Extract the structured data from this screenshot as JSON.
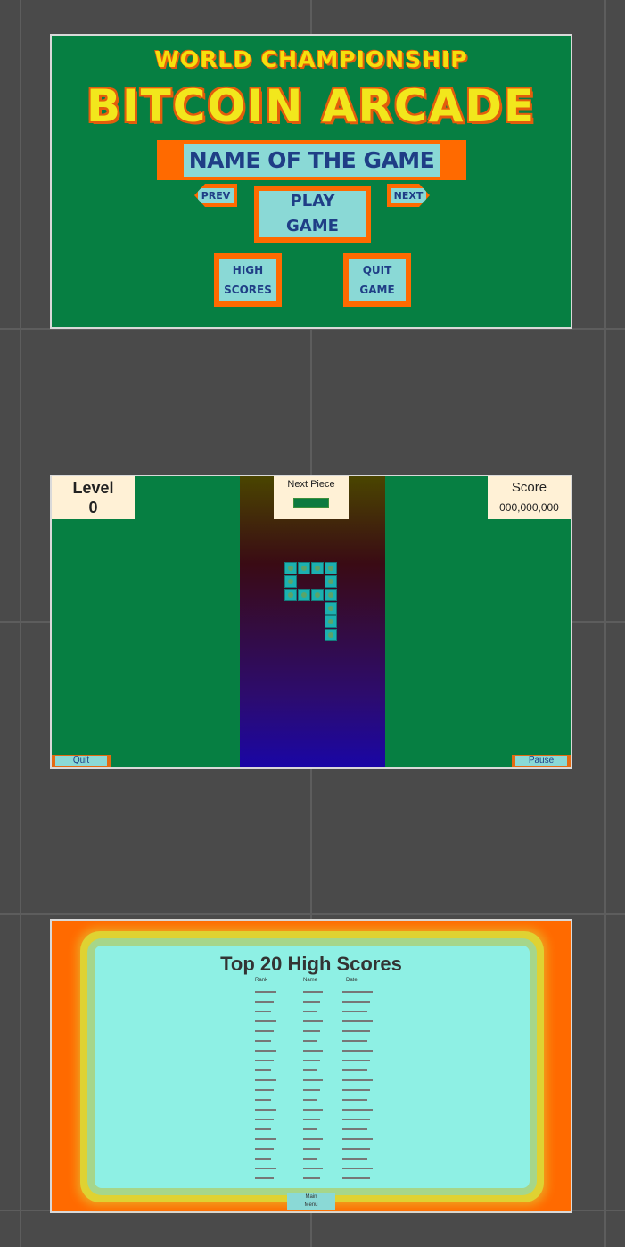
{
  "menu": {
    "subtitle": "WORLD CHAMPIONSHIP",
    "title": "BITCOIN ARCADE",
    "game_name": "NAME OF THE GAME",
    "prev": "PREV",
    "next": "NEXT",
    "play_line1": "PLAY",
    "play_line2": "GAME",
    "high_line1": "HIGH",
    "high_line2": "SCORES",
    "quit_line1": "QUIT",
    "quit_line2": "GAME"
  },
  "game": {
    "level_label": "Level",
    "level_value": "0",
    "next_piece_label": "Next Piece",
    "score_label": "Score",
    "score_value": "000,000,000",
    "quit_label": "Quit",
    "pause_label": "Pause",
    "colors": {
      "field": "#067f42",
      "block": "#1cb0b0",
      "well_top": "#4a4500",
      "well_bottom": "#1a06a5"
    }
  },
  "scores": {
    "title": "Top 20 High Scores",
    "col_rank": "Rank",
    "col_name": "Name",
    "col_date": "Date",
    "main_menu_line1": "Main",
    "main_menu_line2": "Menu"
  }
}
